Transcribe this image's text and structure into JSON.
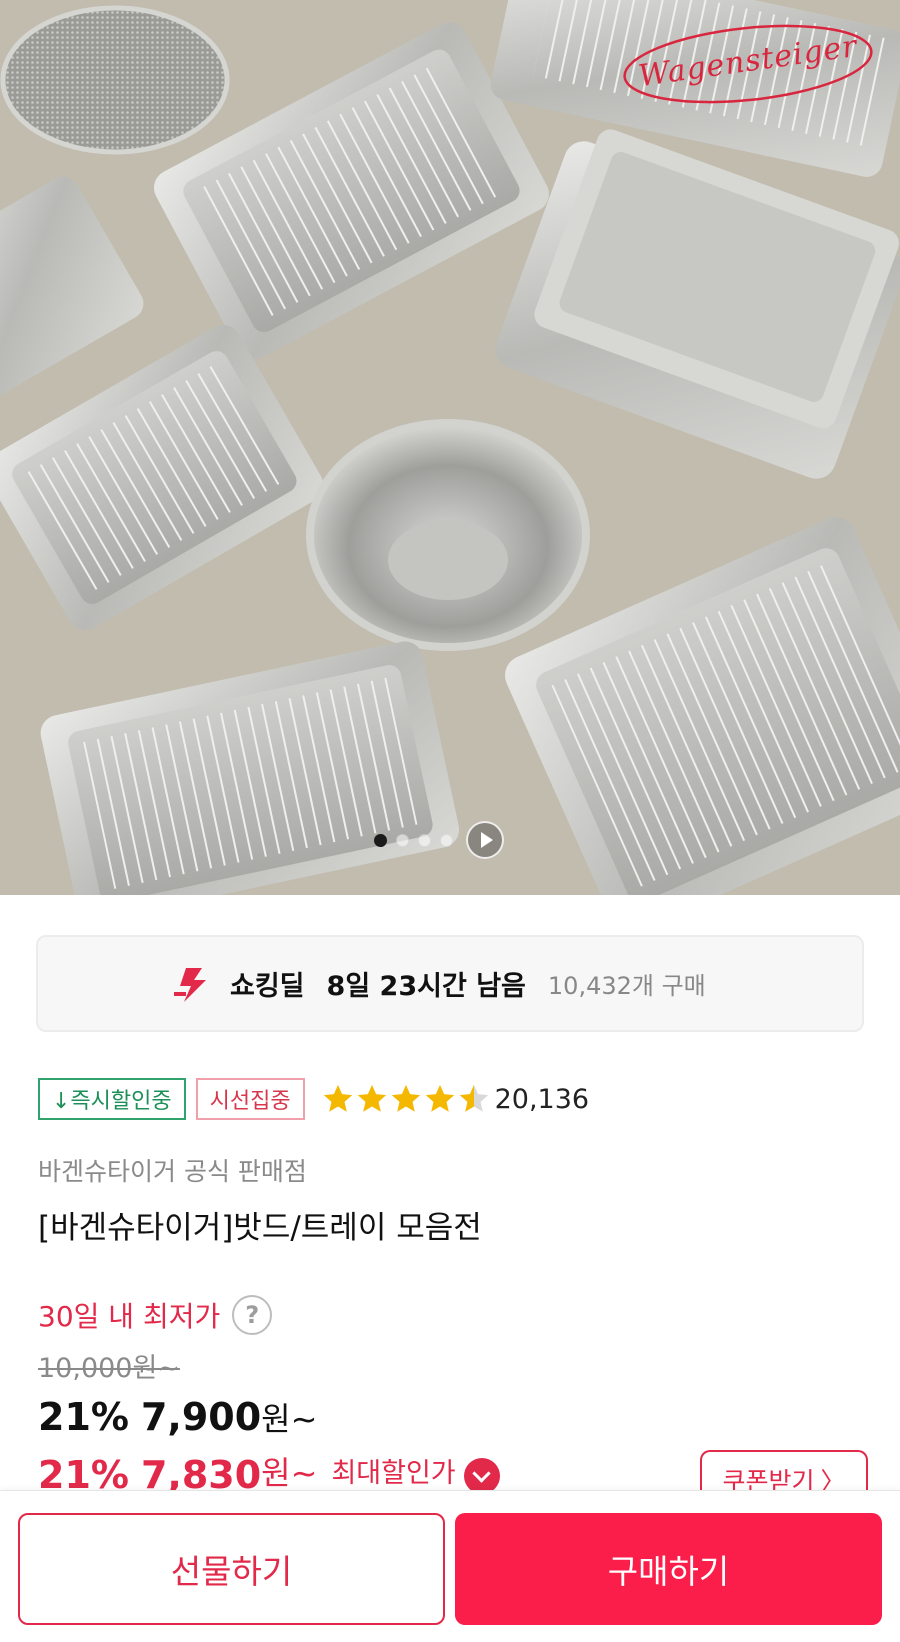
{
  "hero": {
    "image_description": "stainless steel trays, baskets and bowls",
    "brand_watermark": "Wagensteiger",
    "carousel": {
      "total": 4,
      "active_index": 0
    },
    "icons": {
      "next": "play-icon"
    }
  },
  "deal": {
    "icon": "lightning-icon",
    "title": "쇼킹딜",
    "remaining": "8일 23시간 남음",
    "purchase_count": "10,432개 구매"
  },
  "badges": {
    "instant_discount": "↓즉시할인중",
    "attention": "시선집중"
  },
  "rating": {
    "value": 4.5,
    "max": 5,
    "count": "20,136"
  },
  "product": {
    "seller": "바겐슈타이거 공식 판매점",
    "title": "[바겐슈타이거]밧드/트레이 모음전"
  },
  "price": {
    "lowest_label": "30일 내 최저가",
    "help_icon": "?",
    "original": "10,000원~",
    "sale_percent": "21%",
    "sale_price": "7,900",
    "sale_unit": "원~",
    "max_percent": "21%",
    "max_price": "7,830",
    "max_unit": "원~",
    "max_label": "최대할인가",
    "coupon_button": "쿠폰받기",
    "coupon_chevron": "〉"
  },
  "bottom_bar": {
    "gift_button": "선물하기",
    "buy_button": "구매하기"
  },
  "colors": {
    "accent": "#e2294a",
    "buy_button": "#fb1d4a",
    "badge_green": "#1d8f58",
    "star": "#f5b800",
    "hero_bg": "#c1bcae"
  }
}
